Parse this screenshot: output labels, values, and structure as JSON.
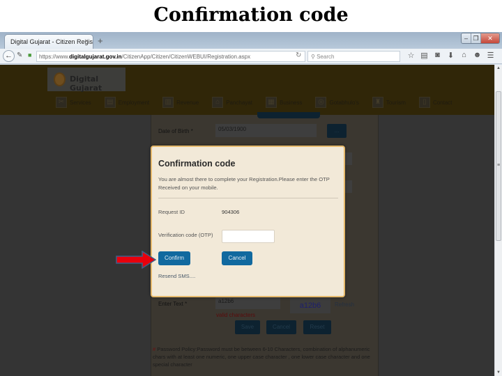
{
  "slide": {
    "title": "Confirmation code"
  },
  "browser": {
    "tab_title": "Digital Gujarat - Citizen Registr...",
    "tab_close": "×",
    "new_tab": "+",
    "url_prefix": "https://www.",
    "url_domain": "digitalgujarat.gov.in",
    "url_path": "/CitizenApp/Citizen/CitizenWEBUI/Registration.aspx",
    "search_placeholder": "Search",
    "window_controls": {
      "minimize": "–",
      "maximize": "❐",
      "close": "✕"
    },
    "toolbar_icons": [
      "☆",
      "▤",
      "◙",
      "⬇",
      "⌂",
      "☻",
      "☰"
    ]
  },
  "site": {
    "logo_text": "Digital Gujarat",
    "menu": [
      {
        "label": "Services",
        "icon": "✂"
      },
      {
        "label": "Employment",
        "icon": "▤"
      },
      {
        "label": "Revenue",
        "icon": "▥"
      },
      {
        "label": "Panchayat",
        "icon": "⌂"
      },
      {
        "label": "Business",
        "icon": "▦"
      },
      {
        "label": "Gotabhulo's",
        "icon": "◎"
      },
      {
        "label": "Tourism",
        "icon": "♜"
      },
      {
        "label": "Contact",
        "icon": "▯"
      }
    ]
  },
  "form_background": {
    "dob_label": "Date of Birth *",
    "dob_value": "05/03/1900",
    "dob_picker": "...",
    "captcha_label": "Enter Text *",
    "captcha_input": "a12b6",
    "captcha_image": "a12b6",
    "refresh_label": "Refresh",
    "invalid_text": "valid characters",
    "buttons": {
      "save": "Save",
      "cancel": "Cancel",
      "reset": "Reset"
    },
    "policy_star": "#",
    "policy_text": " Password Policy:Password must be between 6-10 Characters, combination of alphanumeric chars with at least one numeric, one upper case character , one lower case character and one special character"
  },
  "modal": {
    "title": "Confirmation code",
    "message": "You are almost there to complete your Registration.Please enter the OTP Received on your mobile.",
    "request_id_label": "Request ID",
    "request_id_value": "904306",
    "otp_label": "Verification code (OTP)",
    "otp_value": "",
    "confirm_label": "Confirm",
    "cancel_label": "Cancel",
    "resend_label": "Resend SMS....",
    "button_color": "#11699f"
  },
  "annotation": {
    "arrow_color": "#e8000c",
    "arrow_border": "#3e5f88"
  }
}
